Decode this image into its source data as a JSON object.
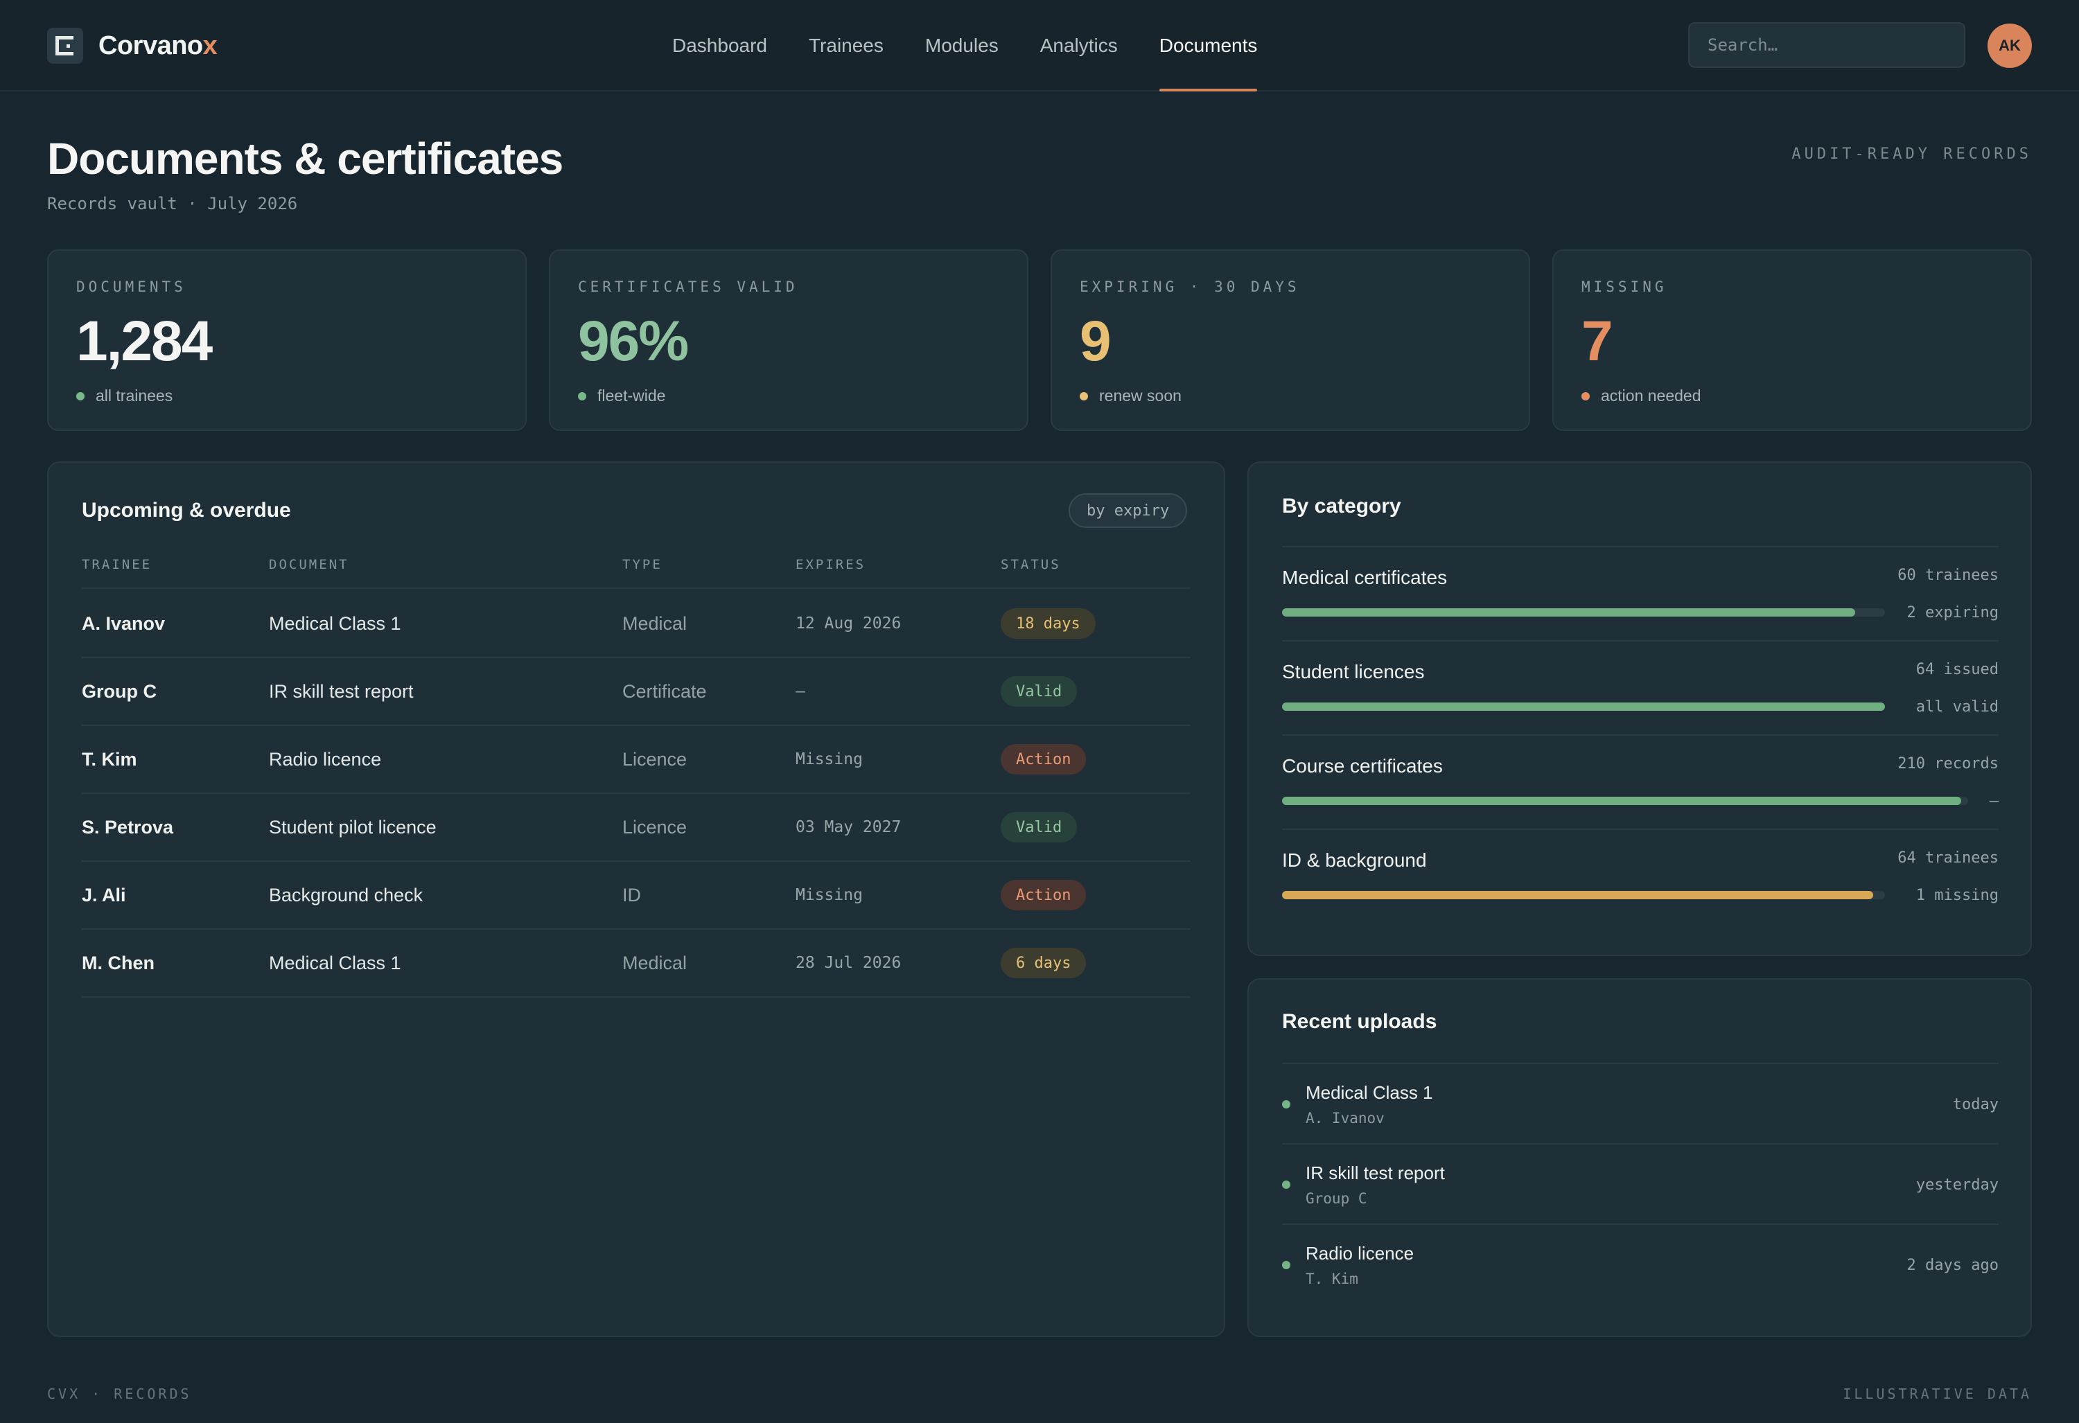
{
  "brand": {
    "name": "Corvano",
    "accent_letter": "x",
    "accent_color": "#e48d5f"
  },
  "nav": [
    {
      "label": "Dashboard",
      "active": false
    },
    {
      "label": "Trainees",
      "active": false
    },
    {
      "label": "Modules",
      "active": false
    },
    {
      "label": "Analytics",
      "active": false
    },
    {
      "label": "Documents",
      "active": true
    }
  ],
  "search": {
    "placeholder": "Search…"
  },
  "user": {
    "initials": "AK"
  },
  "page": {
    "title": "Documents & certificates",
    "subtitle": "Records vault · July 2026",
    "tag": "AUDIT-READY RECORDS"
  },
  "stats": [
    {
      "label": "DOCUMENTS",
      "value": "1,284",
      "foot": "all trainees",
      "color": "#f4f5f3",
      "dot": "#78b98a"
    },
    {
      "label": "CERTIFICATES VALID",
      "value": "96%",
      "foot": "fleet-wide",
      "color": "#8fc39f",
      "dot": "#78b98a"
    },
    {
      "label": "EXPIRING · 30 DAYS",
      "value": "9",
      "foot": "renew soon",
      "color": "#e8c074",
      "dot": "#e8c074"
    },
    {
      "label": "MISSING",
      "value": "7",
      "foot": "action needed",
      "color": "#e58e62",
      "dot": "#e58e62"
    }
  ],
  "table": {
    "title": "Upcoming & overdue",
    "chip": "by expiry",
    "columns": [
      "TRAINEE",
      "DOCUMENT",
      "TYPE",
      "EXPIRES",
      "STATUS"
    ],
    "rows": [
      {
        "trainee": "A. Ivanov",
        "document": "Medical Class 1",
        "type": "Medical",
        "expires": "12 Aug 2026",
        "status": "18 days",
        "tone": "warn"
      },
      {
        "trainee": "Group C",
        "document": "IR skill test report",
        "type": "Certificate",
        "expires": "–",
        "status": "Valid",
        "tone": "ok"
      },
      {
        "trainee": "T. Kim",
        "document": "Radio licence",
        "type": "Licence",
        "expires": "Missing",
        "status": "Action",
        "tone": "bad"
      },
      {
        "trainee": "S. Petrova",
        "document": "Student pilot licence",
        "type": "Licence",
        "expires": "03 May 2027",
        "status": "Valid",
        "tone": "ok"
      },
      {
        "trainee": "J. Ali",
        "document": "Background check",
        "type": "ID",
        "expires": "Missing",
        "status": "Action",
        "tone": "bad"
      },
      {
        "trainee": "M. Chen",
        "document": "Medical Class 1",
        "type": "Medical",
        "expires": "28 Jul 2026",
        "status": "6 days",
        "tone": "warn"
      }
    ]
  },
  "categories": {
    "title": "By category",
    "items": [
      {
        "name": "Medical certificates",
        "meta1": "60 trainees",
        "meta2": "2 expiring",
        "fill": 0.95,
        "color": "#6fae80"
      },
      {
        "name": "Student licences",
        "meta1": "64 issued",
        "meta2": "all valid",
        "fill": 1.0,
        "color": "#6fae80"
      },
      {
        "name": "Course certificates",
        "meta1": "210 records",
        "meta2": "–",
        "fill": 0.99,
        "color": "#6fae80"
      },
      {
        "name": "ID & background",
        "meta1": "64 trainees",
        "meta2": "1 missing",
        "fill": 0.98,
        "color": "#d8a857"
      }
    ]
  },
  "uploads": {
    "title": "Recent uploads",
    "items": [
      {
        "title": "Medical Class 1",
        "sub": "A. Ivanov",
        "when": "today"
      },
      {
        "title": "IR skill test report",
        "sub": "Group C",
        "when": "yesterday"
      },
      {
        "title": "Radio licence",
        "sub": "T. Kim",
        "when": "2 days ago"
      }
    ]
  },
  "footer": {
    "left": "CVX · RECORDS",
    "right": "ILLUSTRATIVE DATA"
  }
}
